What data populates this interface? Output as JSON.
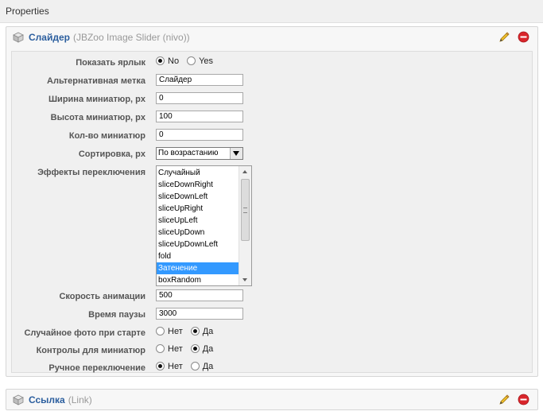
{
  "header": {
    "title": "Properties"
  },
  "elements": [
    {
      "name": "Слайдер",
      "type": "(JBZoo Image Slider (nivo))",
      "fields": {
        "show_label": {
          "label": "Показать ярлык",
          "options": [
            "No",
            "Yes"
          ],
          "selected": "No"
        },
        "alt_label": {
          "label": "Альтернативная метка",
          "value": "Слайдер"
        },
        "thumb_width": {
          "label": "Ширина миниатюр, px",
          "value": "0"
        },
        "thumb_height": {
          "label": "Высота миниатюр, px",
          "value": "100"
        },
        "thumb_count": {
          "label": "Кол-во миниатюр",
          "value": "0"
        },
        "sorting": {
          "label": "Сортировка, px",
          "value": "По возрастанию"
        },
        "effects": {
          "label": "Эффекты переключения",
          "options": [
            "Случайный",
            "sliceDownRight",
            "sliceDownLeft",
            "sliceUpRight",
            "sliceUpLeft",
            "sliceUpDown",
            "sliceUpDownLeft",
            "fold",
            "Затенение",
            "boxRandom"
          ],
          "selected": "Затенение"
        },
        "anim_speed": {
          "label": "Скорость анимации",
          "value": "500"
        },
        "pause_time": {
          "label": "Время паузы",
          "value": "3000"
        },
        "random_start": {
          "label": "Случайное фото при старте",
          "options": [
            "Нет",
            "Да"
          ],
          "selected": "Да"
        },
        "thumb_controls": {
          "label": "Контролы для миниатюр",
          "options": [
            "Нет",
            "Да"
          ],
          "selected": "Да"
        },
        "manual_advance": {
          "label": "Ручное переключение",
          "options": [
            "Нет",
            "Да"
          ],
          "selected": "Нет"
        }
      }
    },
    {
      "name": "Ссылка",
      "type": "(Link)"
    }
  ],
  "icons": {
    "element": "cube-icon",
    "edit": "pencil-icon",
    "delete": "delete-icon"
  },
  "colors": {
    "element_name": "#2b5e9e",
    "selected_option": "#3399ff",
    "delete": "#d9252b"
  }
}
